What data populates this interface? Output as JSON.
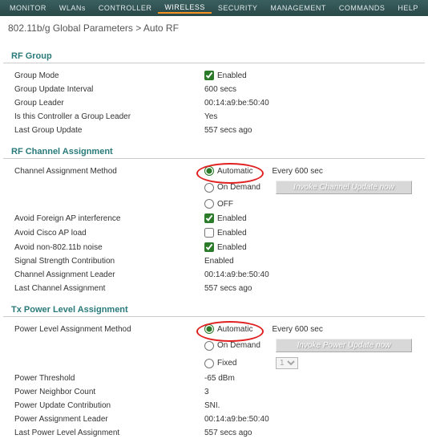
{
  "nav": {
    "monitor": "MONITOR",
    "wlans": "WLANs",
    "controller": "CONTROLLER",
    "wireless": "WIRELESS",
    "security": "SECURITY",
    "management": "MANAGEMENT",
    "commands": "COMMANDS",
    "help": "HELP"
  },
  "breadcrumb": "802.11b/g Global Parameters > Auto RF",
  "labels": {
    "enabled": "Enabled",
    "automatic": "Automatic",
    "on_demand": "On Demand",
    "off": "OFF",
    "fixed": "Fixed"
  },
  "sections": {
    "rf_group": {
      "title": "RF Group",
      "group_mode": {
        "label": "Group Mode"
      },
      "group_update_interval": {
        "label": "Group Update Interval",
        "value": "600 secs"
      },
      "group_leader": {
        "label": "Group Leader",
        "value": "00:14:a9:be:50:40"
      },
      "is_leader": {
        "label": "Is this Controller a Group Leader",
        "value": "Yes"
      },
      "last_update": {
        "label": "Last Group Update",
        "value": "557 secs ago"
      }
    },
    "rf_channel": {
      "title": "RF Channel Assignment",
      "method_label": "Channel Assignment Method",
      "every": "Every 600 sec",
      "invoke_btn": "Invoke Channel Update now",
      "avoid_foreign": {
        "label": "Avoid Foreign AP interference"
      },
      "avoid_cisco": {
        "label": "Avoid Cisco AP load"
      },
      "avoid_non80211b": {
        "label": "Avoid non-802.11b noise"
      },
      "signal_strength": {
        "label": "Signal Strength Contribution",
        "value": "Enabled"
      },
      "assignment_leader": {
        "label": "Channel Assignment Leader",
        "value": "00:14:a9:be:50:40"
      },
      "last_assignment": {
        "label": "Last Channel Assignment",
        "value": "557 secs ago"
      }
    },
    "tx_power": {
      "title": "Tx Power Level Assignment",
      "method_label": "Power Level Assignment Method",
      "every": "Every 600 sec",
      "invoke_btn": "Invoke Power Update now",
      "fixed_value": "1",
      "threshold": {
        "label": "Power Threshold",
        "value": "-65 dBm"
      },
      "neighbor_count": {
        "label": "Power Neighbor Count",
        "value": "3"
      },
      "update_contrib": {
        "label": "Power Update Contribution",
        "value": "SNI."
      },
      "assignment_leader": {
        "label": "Power Assignment Leader",
        "value": "00:14:a9:be:50:40"
      },
      "last_assignment": {
        "label": "Last Power Level Assignment",
        "value": "557 secs ago"
      }
    }
  }
}
